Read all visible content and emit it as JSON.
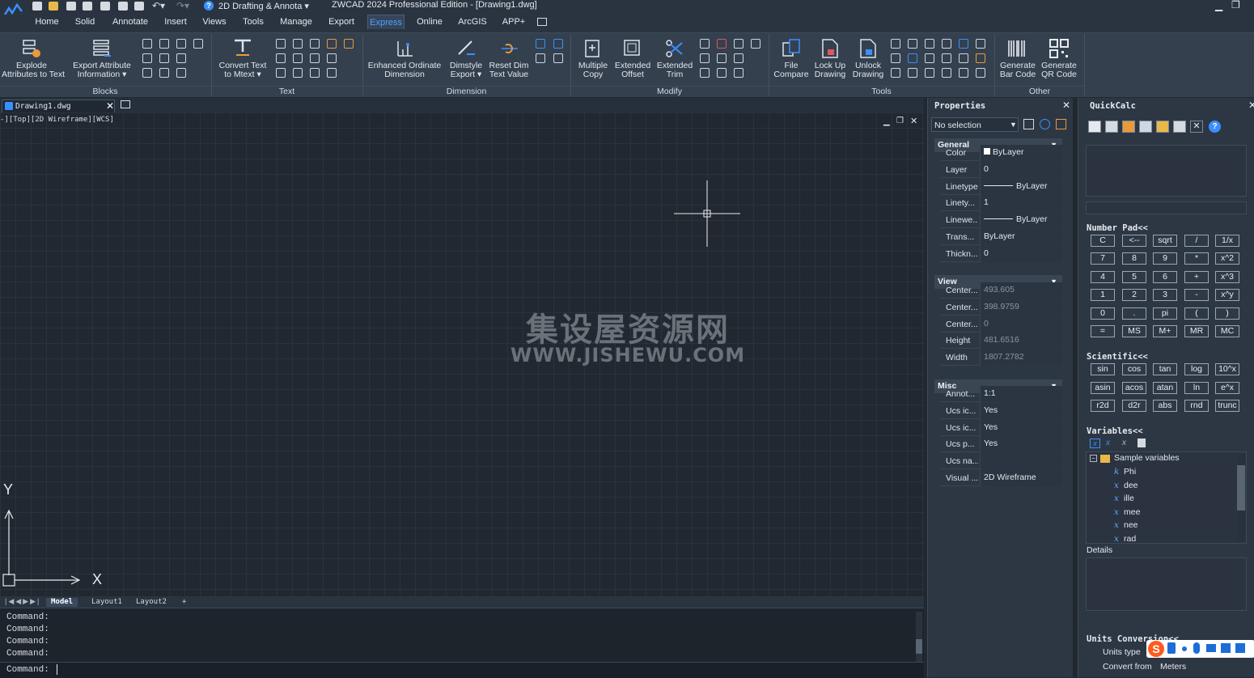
{
  "app": {
    "workspace": "2D Drafting & Annota",
    "title": "ZWCAD 2024 Professional Edition - [Drawing1.dwg]"
  },
  "menu": [
    "Home",
    "Solid",
    "Annotate",
    "Insert",
    "Views",
    "Tools",
    "Manage",
    "Export",
    "Express",
    "Online",
    "ArcGIS",
    "APP+"
  ],
  "ribbon": {
    "blocks": {
      "btn1": "Explode\nAttributes to Text",
      "btn2": "Export Attribute\nInformation ▾",
      "group": "Blocks"
    },
    "text": {
      "btn1": "Convert Text\nto Mtext ▾",
      "group": "Text"
    },
    "dimension": {
      "btn1": "Enhanced Ordinate\nDimension",
      "btn2": "Dimstyle\nExport ▾",
      "btn3": "Reset Dim\nText Value",
      "group": "Dimension"
    },
    "modify": {
      "btn1": "Multiple\nCopy",
      "btn2": "Extended\nOffset",
      "btn3": "Extended\nTrim",
      "group": "Modify"
    },
    "tools": {
      "btn1": "File\nCompare",
      "btn2": "Lock Up\nDrawing",
      "btn3": "Unlock\nDrawing",
      "group": "Tools"
    },
    "other": {
      "btn1": "Generate\nBar Code",
      "btn2": "Generate\nQR Code",
      "group": "Other"
    }
  },
  "doc_tab": "Drawing1.dwg",
  "viewport_label": "-][Top][2D Wireframe][WCS]",
  "watermark": {
    "line1": "集设屋资源网",
    "line2": "WWW.JISHEWU.COM"
  },
  "ucs": {
    "y": "Y",
    "x": "X"
  },
  "layout_tabs": [
    "Model",
    "Layout1",
    "Layout2",
    "+"
  ],
  "command": {
    "history": [
      "Command:",
      "Command:",
      "Command:",
      "Command:"
    ],
    "prompt": "Command:"
  },
  "properties": {
    "title": "Properties",
    "selection": "No selection",
    "general": {
      "label": "General",
      "rows": [
        {
          "k": "Color",
          "v": "ByLayer"
        },
        {
          "k": "Layer",
          "v": "0"
        },
        {
          "k": "Linetype",
          "v": "ByLayer"
        },
        {
          "k": "Linety...",
          "v": "1"
        },
        {
          "k": "Linewe...",
          "v": "ByLayer"
        },
        {
          "k": "Trans...",
          "v": "ByLayer"
        },
        {
          "k": "Thickn...",
          "v": "0"
        }
      ]
    },
    "view": {
      "label": "View",
      "rows": [
        {
          "k": "Center...",
          "v": "493.605"
        },
        {
          "k": "Center...",
          "v": "398.9759"
        },
        {
          "k": "Center...",
          "v": "0"
        },
        {
          "k": "Height",
          "v": "481.6516"
        },
        {
          "k": "Width",
          "v": "1807.2782"
        }
      ]
    },
    "misc": {
      "label": "Misc",
      "rows": [
        {
          "k": "Annot...",
          "v": "1:1"
        },
        {
          "k": "Ucs ic...",
          "v": "Yes"
        },
        {
          "k": "Ucs ic...",
          "v": "Yes"
        },
        {
          "k": "Ucs p...",
          "v": "Yes"
        },
        {
          "k": "Ucs na...",
          "v": ""
        },
        {
          "k": "Visual ...",
          "v": "2D Wireframe"
        }
      ]
    }
  },
  "quickcalc": {
    "title": "QuickCalc",
    "numpad_label": "Number Pad<<",
    "numpad": [
      [
        "C",
        "<--",
        "sqrt",
        "/",
        "1/x"
      ],
      [
        "7",
        "8",
        "9",
        "*",
        "x^2"
      ],
      [
        "4",
        "5",
        "6",
        "+",
        "x^3"
      ],
      [
        "1",
        "2",
        "3",
        "-",
        "x^y"
      ],
      [
        "0",
        ".",
        "pi",
        "(",
        ")"
      ],
      [
        "=",
        "MS",
        "M+",
        "MR",
        "MC"
      ]
    ],
    "sci_label": "Scientific<<",
    "sci": [
      [
        "sin",
        "cos",
        "tan",
        "log",
        "10^x"
      ],
      [
        "asin",
        "acos",
        "atan",
        "ln",
        "e^x"
      ],
      [
        "r2d",
        "d2r",
        "abs",
        "rnd",
        "trunc"
      ]
    ],
    "vars_label": "Variables<<",
    "vars_root": "Sample variables",
    "vars": [
      {
        "icon": "k",
        "name": "Phi"
      },
      {
        "icon": "x",
        "name": "dee"
      },
      {
        "icon": "x",
        "name": "ille"
      },
      {
        "icon": "x",
        "name": "mee"
      },
      {
        "icon": "x",
        "name": "nee"
      },
      {
        "icon": "x",
        "name": "rad"
      }
    ],
    "details_label": "Details",
    "units_label": "Units Conversion<<",
    "units_type": "Units type",
    "convert_from": "Convert from",
    "convert_from_value": "Meters"
  }
}
